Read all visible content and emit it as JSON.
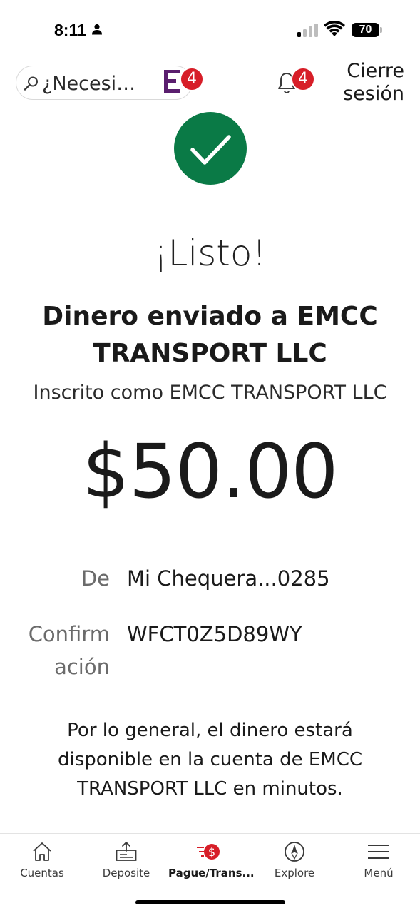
{
  "status_bar": {
    "time": "8:11",
    "battery": "70",
    "icons": [
      "person-icon",
      "signal-icon",
      "wifi-icon",
      "battery-icon"
    ]
  },
  "header": {
    "search_placeholder": "¿Necesi…",
    "assistant_badge": "4",
    "notification_badge": "4",
    "logout_line1": "Cierre",
    "logout_line2": "sesión"
  },
  "success": {
    "headline": "¡Listo!",
    "title": "Dinero enviado a EMCC TRANSPORT LLC",
    "enrolled_as": "Inscrito como EMCC TRANSPORT LLC",
    "amount": "$50.00",
    "details": {
      "from_label": "De",
      "from_value": "Mi Chequera...0285",
      "confirmation_label": "Confirm ación",
      "confirmation_value": "WFCT0Z5D89WY"
    },
    "note": "Por lo general, el dinero estará disponible en la cuenta de EMCC TRANSPORT LLC en minutos."
  },
  "bottom_nav": {
    "items": [
      {
        "label": "Cuentas",
        "icon": "home-icon"
      },
      {
        "label": "Deposite",
        "icon": "deposit-icon"
      },
      {
        "label": "Pague/Trans...",
        "icon": "pay-transfer-icon",
        "active": true
      },
      {
        "label": "Explore",
        "icon": "compass-icon"
      },
      {
        "label": "Menú",
        "icon": "hamburger-menu-icon"
      }
    ]
  },
  "colors": {
    "success_green": "#0a7a46",
    "brand_red": "#d71e28",
    "brand_purple": "#5a1e6e",
    "text": "#1a1a1a",
    "muted_text": "#6b6b6b"
  }
}
